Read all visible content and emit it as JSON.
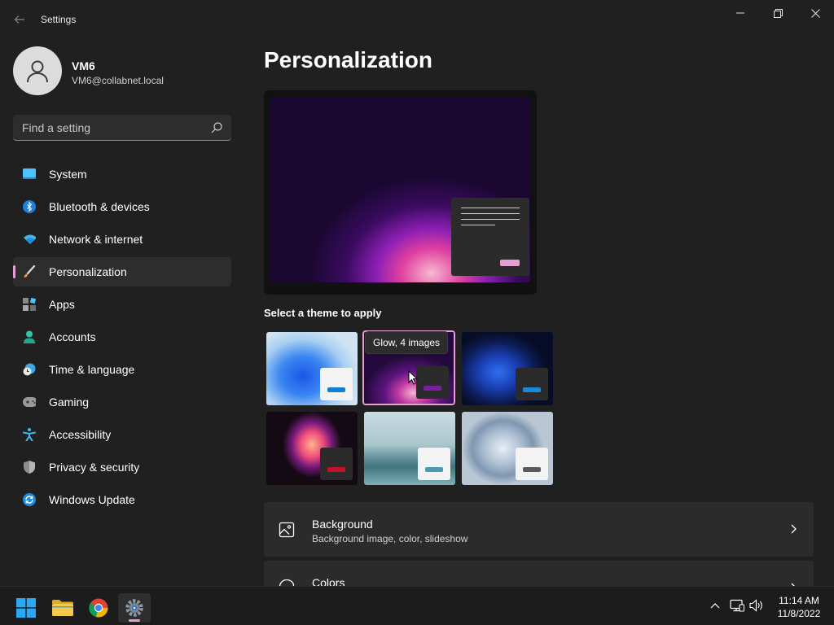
{
  "window": {
    "title": "Settings"
  },
  "profile": {
    "name": "VM6",
    "email": "VM6@collabnet.local"
  },
  "search": {
    "placeholder": "Find a setting"
  },
  "nav": {
    "items": [
      {
        "label": "System",
        "icon": "monitor-icon"
      },
      {
        "label": "Bluetooth & devices",
        "icon": "bluetooth-icon"
      },
      {
        "label": "Network & internet",
        "icon": "wifi-icon"
      },
      {
        "label": "Personalization",
        "icon": "brush-icon",
        "active": true
      },
      {
        "label": "Apps",
        "icon": "apps-icon"
      },
      {
        "label": "Accounts",
        "icon": "person-icon"
      },
      {
        "label": "Time & language",
        "icon": "clock-globe-icon"
      },
      {
        "label": "Gaming",
        "icon": "controller-icon"
      },
      {
        "label": "Accessibility",
        "icon": "accessibility-icon"
      },
      {
        "label": "Privacy & security",
        "icon": "shield-icon"
      },
      {
        "label": "Windows Update",
        "icon": "update-icon"
      }
    ]
  },
  "main": {
    "title": "Personalization",
    "themes_label": "Select a theme to apply",
    "tooltip": "Glow, 4 images",
    "rows": [
      {
        "title": "Background",
        "subtitle": "Background image, color, slideshow",
        "icon": "image-icon"
      },
      {
        "title": "Colors",
        "subtitle": "",
        "icon": "palette-icon"
      }
    ]
  },
  "colors": {
    "accent": "#e3a0d4",
    "background": "#202020",
    "card": "#2b2b2b"
  },
  "taskbar": {
    "time": "11:14 AM",
    "date": "11/8/2022"
  }
}
